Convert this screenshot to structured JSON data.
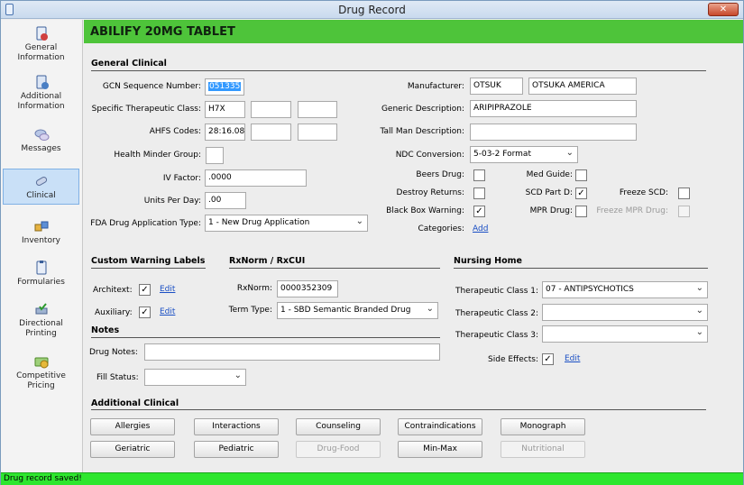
{
  "window": {
    "title": "Drug Record"
  },
  "sidebar": {
    "items": [
      {
        "label": "General Information",
        "icon": "document-blue-icon"
      },
      {
        "label": "Additional Information",
        "icon": "document-badge-icon"
      },
      {
        "label": "Messages",
        "icon": "speech-bubbles-icon"
      },
      {
        "label": "Clinical",
        "icon": "capsule-pill-icon",
        "active": true
      },
      {
        "label": "Inventory",
        "icon": "boxes-icon"
      },
      {
        "label": "Formularies",
        "icon": "document-list-icon"
      },
      {
        "label": "Directional Printing",
        "icon": "printer-check-icon"
      },
      {
        "label": "Competitive Pricing",
        "icon": "money-icon"
      }
    ]
  },
  "header": {
    "title": "ABILIFY 20MG TABLET"
  },
  "general_clinical": {
    "section_title": "General Clinical",
    "gcn_label": "GCN Sequence Number:",
    "gcn_value": "051335",
    "stc_label": "Specific Therapeutic Class:",
    "stc_values": [
      "H7X",
      "",
      ""
    ],
    "ahfs_label": "AHFS Codes:",
    "ahfs_values": [
      "28:16.08",
      "",
      ""
    ],
    "hmg_label": "Health Minder Group:",
    "hmg_value": "",
    "iv_label": "IV Factor:",
    "iv_value": ".0000",
    "upd_label": "Units Per Day:",
    "upd_value": ".00",
    "fda_label": "FDA Drug Application Type:",
    "fda_value": "1 - New Drug Application",
    "manufacturer_label": "Manufacturer:",
    "manufacturer_code": "OTSUK",
    "manufacturer_name": "OTSUKA AMERICA",
    "generic_label": "Generic Description:",
    "generic_value": "ARIPIPRAZOLE",
    "tallman_label": "Tall Man Description:",
    "tallman_value": "",
    "ndc_label": "NDC Conversion:",
    "ndc_value": "5-03-2 Format",
    "beers_label": "Beers Drug:",
    "medguide_label": "Med Guide:",
    "destroy_label": "Destroy Returns:",
    "scd_label": "SCD Part D:",
    "freeze_scd_label": "Freeze SCD:",
    "blackbox_label": "Black Box Warning:",
    "mpr_label": "MPR Drug:",
    "freeze_mpr_label": "Freeze MPR Drug:",
    "categories_label": "Categories:",
    "categories_link": "Add",
    "check_mark": "✓"
  },
  "custom_warning": {
    "section_title": "Custom Warning Labels",
    "architext_label": "Architext:",
    "auxiliary_label": "Auxiliary:",
    "edit_link": "Edit"
  },
  "rxnorm": {
    "section_title": "RxNorm / RxCUI",
    "rxnorm_label": "RxNorm:",
    "rxnorm_value": "0000352309",
    "termtype_label": "Term Type:",
    "termtype_value": "1 - SBD Semantic Branded Drug"
  },
  "notes": {
    "section_title": "Notes",
    "drugnotes_label": "Drug Notes:",
    "drugnotes_value": "",
    "fillstatus_label": "Fill Status:",
    "fillstatus_value": ""
  },
  "nursing_home": {
    "section_title": "Nursing Home",
    "tc1_label": "Therapeutic Class 1:",
    "tc1_value": "07 - ANTIPSYCHOTICS",
    "tc2_label": "Therapeutic Class 2:",
    "tc2_value": "",
    "tc3_label": "Therapeutic Class 3:",
    "tc3_value": "",
    "side_effects_label": "Side Effects:",
    "edit_link": "Edit"
  },
  "additional_clinical": {
    "section_title": "Additional Clinical",
    "buttons": [
      "Allergies",
      "Interactions",
      "Counseling",
      "Contraindications",
      "Monograph",
      "Geriatric",
      "Pediatric",
      "Drug-Food",
      "Min-Max",
      "Nutritional"
    ]
  },
  "status": {
    "text": "Drug record saved!"
  },
  "colors": {
    "header": "#4ec43a",
    "status": "#2ee62e",
    "link": "#1a4fc4"
  }
}
